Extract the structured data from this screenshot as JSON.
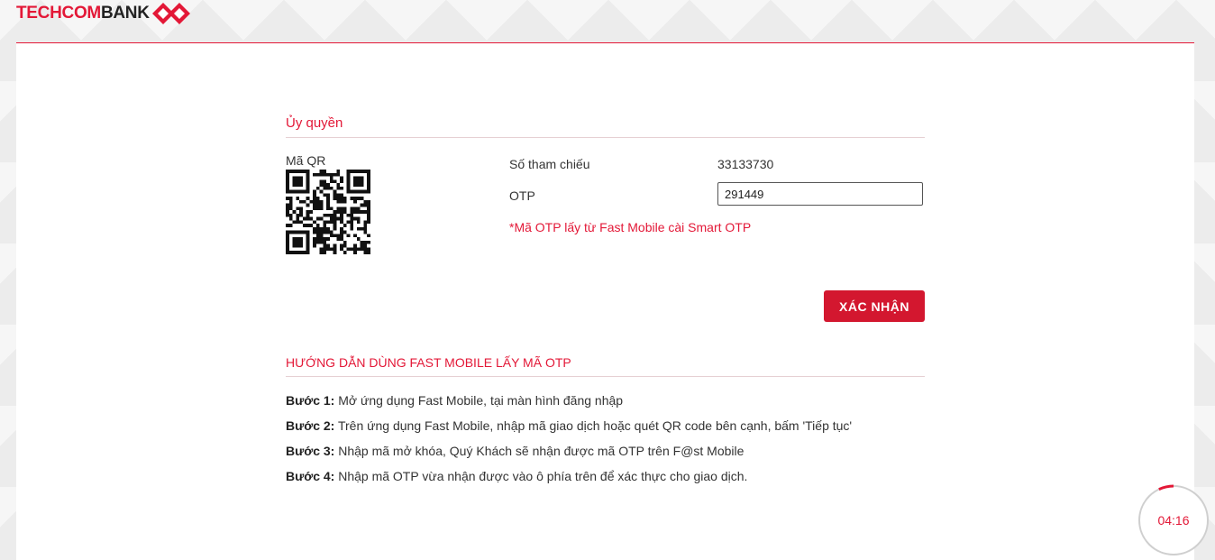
{
  "brand": {
    "name_part1": "TECHCOM",
    "name_part2": "BANK",
    "accent_color": "#e31837"
  },
  "authorize": {
    "title": "Ủy quyền",
    "qr_label": "Mã QR",
    "ref_label": "Số tham chiếu",
    "ref_value": "33133730",
    "otp_label": "OTP",
    "otp_value": "291449",
    "otp_note": "*Mã OTP lấy từ Fast Mobile cài Smart OTP",
    "confirm_label": "XÁC NHẬN"
  },
  "guide": {
    "title": "HƯỚNG DẪN DÙNG FAST MOBILE LẤY MÃ OTP",
    "steps": [
      {
        "label": "Bước 1:",
        "text": "Mở ứng dụng Fast Mobile, tại màn hình đăng nhập"
      },
      {
        "label": "Bước 2:",
        "text": "Trên ứng dụng Fast Mobile, nhập mã giao dịch hoặc quét QR code bên cạnh, bấm 'Tiếp tục'"
      },
      {
        "label": "Bước 3:",
        "text": "Nhập mã mở khóa, Quý Khách sẽ nhận được mã OTP trên F@st Mobile"
      },
      {
        "label": "Bước 4:",
        "text": "Nhập mã OTP vừa nhận được vào ô phía trên để xác thực cho giao dịch."
      }
    ]
  },
  "timer": {
    "text": "04:16",
    "progress": 0.07
  },
  "icons": {
    "logo": "techcombank-diamond-icon",
    "qr": "qr-code-icon"
  }
}
